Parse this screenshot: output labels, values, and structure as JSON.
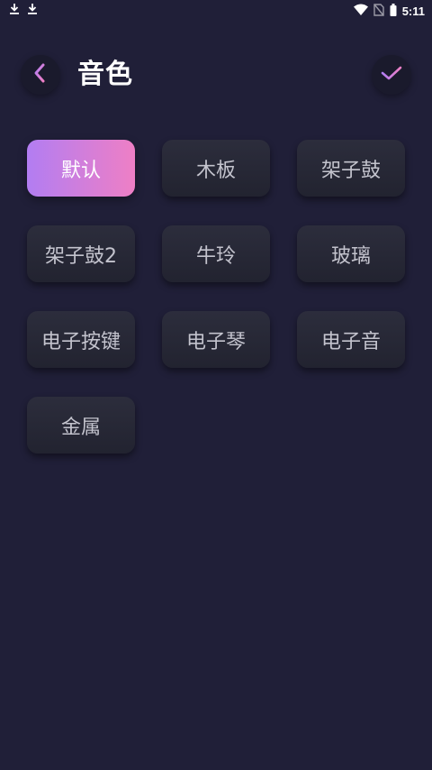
{
  "status_bar": {
    "time": "5:11",
    "left_icons": [
      "download-icon",
      "download-icon"
    ],
    "right_icons": [
      "wifi-icon",
      "no-sim-icon",
      "battery-icon"
    ]
  },
  "header": {
    "title": "音色",
    "back_icon": "chevron-left-icon",
    "confirm_icon": "check-icon"
  },
  "colors": {
    "background": "#201f38",
    "accent_start": "#b27df2",
    "accent_end": "#ee7fc5",
    "tile": "#262734",
    "tile_text": "#c3c3cd"
  },
  "tones": [
    {
      "label": "默认",
      "selected": true
    },
    {
      "label": "木板",
      "selected": false
    },
    {
      "label": "架子鼓",
      "selected": false
    },
    {
      "label": "架子鼓2",
      "selected": false
    },
    {
      "label": "牛玲",
      "selected": false
    },
    {
      "label": "玻璃",
      "selected": false
    },
    {
      "label": "电子按键",
      "selected": false
    },
    {
      "label": "电子琴",
      "selected": false
    },
    {
      "label": "电子音",
      "selected": false
    },
    {
      "label": "金属",
      "selected": false
    }
  ]
}
